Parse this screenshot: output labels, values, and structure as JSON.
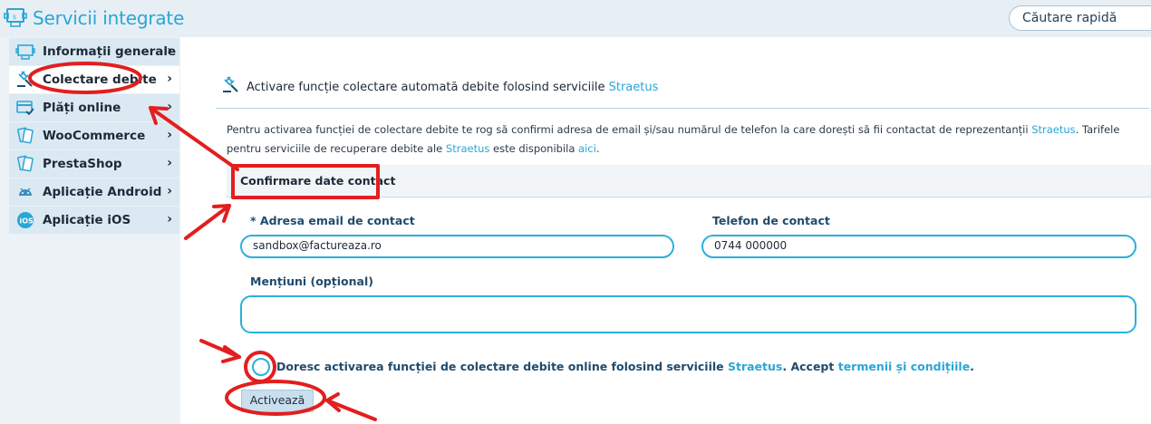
{
  "header": {
    "app_title": "Servicii integrate",
    "search_placeholder": "Căutare rapidă"
  },
  "sidebar": {
    "items": [
      {
        "label": "Informații generale",
        "icon": "monitor-icon",
        "active": false
      },
      {
        "label": "Colectare debite",
        "icon": "gavel-icon",
        "active": true
      },
      {
        "label": "Plăți online",
        "icon": "card-icon",
        "active": false
      },
      {
        "label": "WooCommerce",
        "icon": "cards-icon",
        "active": false
      },
      {
        "label": "PrestaShop",
        "icon": "cards-icon",
        "active": false
      },
      {
        "label": "Aplicație Android",
        "icon": "android-icon",
        "active": false
      },
      {
        "label": "Aplicație iOS",
        "icon": "ios-icon",
        "active": false
      }
    ],
    "chevron": "›"
  },
  "main": {
    "heading_prefix": "Activare funcție colectare automată debite folosind serviciile",
    "heading_brand": "Straetus",
    "description": {
      "part1": "Pentru activarea funcției de colectare debite te rog să confirmi adresa de email și/sau numărul de telefon la care dorești să fii contactat de reprezentanții",
      "brand1": "Straetus",
      "part2": ". Tarifele pentru serviciile de recuperare debite ale",
      "brand2": "Straetus",
      "part3": "este disponibila",
      "link": "aici",
      "part4": "."
    },
    "section_title": "Confirmare date contact",
    "email_label": "* Adresa email de contact",
    "email_value": "sandbox@factureaza.ro",
    "phone_label": "Telefon de contact",
    "phone_value": "0744 000000",
    "notes_label": "Mențiuni (opțional)",
    "notes_value": "",
    "consent": {
      "part1": "Doresc activarea funcției de colectare debite online folosind serviciile",
      "brand": "Straetus",
      "part2": ". Accept",
      "terms_link": "termenii și condițiile",
      "part3": "."
    },
    "activate_button": "Activează"
  },
  "colors": {
    "accent": "#2aa6d6",
    "annotation_red": "#e31e1e",
    "nav_bg": "#dbe9f2",
    "label_blue": "#1f4b6e"
  }
}
